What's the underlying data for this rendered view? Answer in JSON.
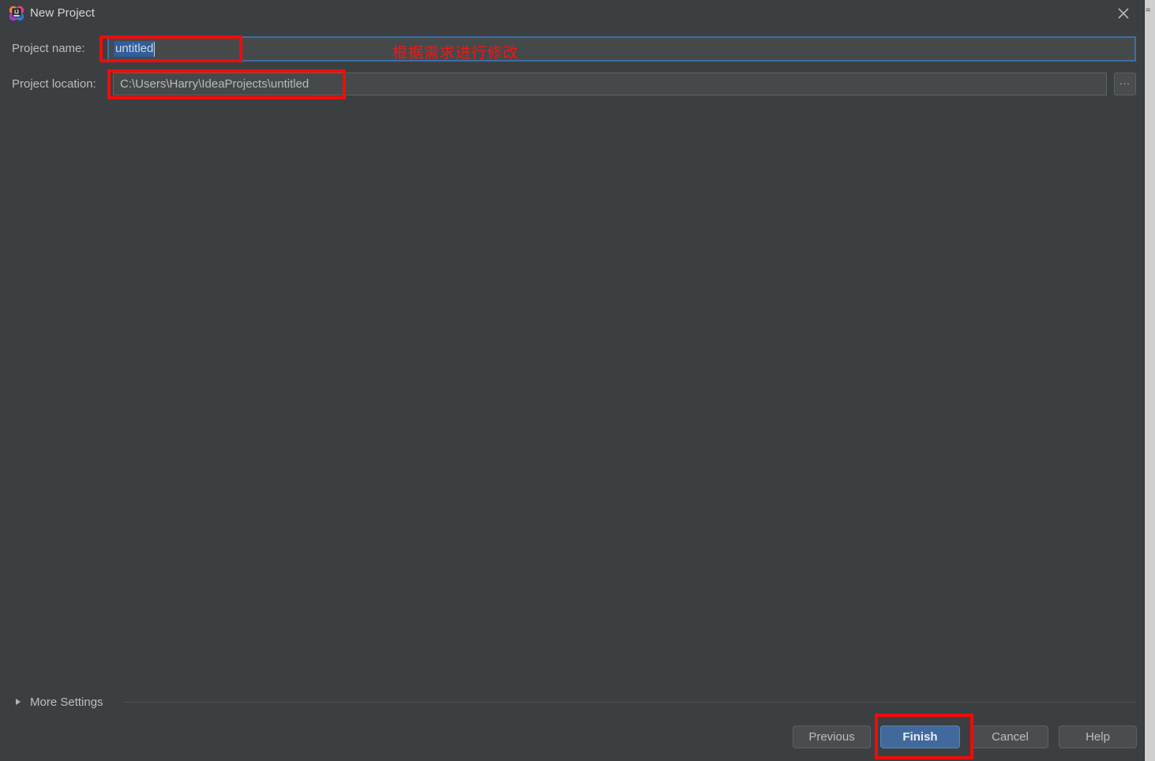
{
  "window": {
    "title": "New Project",
    "app_icon": "intellij-idea-icon",
    "close_icon": "close-icon"
  },
  "form": {
    "project_name": {
      "label": "Project name:",
      "value": "untitled",
      "selected": true,
      "focused": true
    },
    "project_location": {
      "label": "Project location:",
      "value": "C:\\Users\\Harry\\IdeaProjects\\untitled",
      "browse_label": "..."
    }
  },
  "annotations": {
    "note": "根据需求进行修改",
    "note_color": "#f21616",
    "highlight_color": "#f20b0b"
  },
  "more_settings": {
    "label": "More Settings",
    "expanded": false,
    "chevron_icon": "triangle-right-icon"
  },
  "footer": {
    "previous_label": "Previous",
    "finish_label": "Finish",
    "cancel_label": "Cancel",
    "help_label": "Help",
    "primary_color": "#41699c"
  },
  "theme": {
    "dialog_bg": "#3c3f41",
    "input_bg": "#45494a",
    "focus_border": "#3c6ea5",
    "selection_bg": "#2f5d9e",
    "text": "#bbbbbb"
  },
  "background_page": {
    "glyph": "≈"
  }
}
